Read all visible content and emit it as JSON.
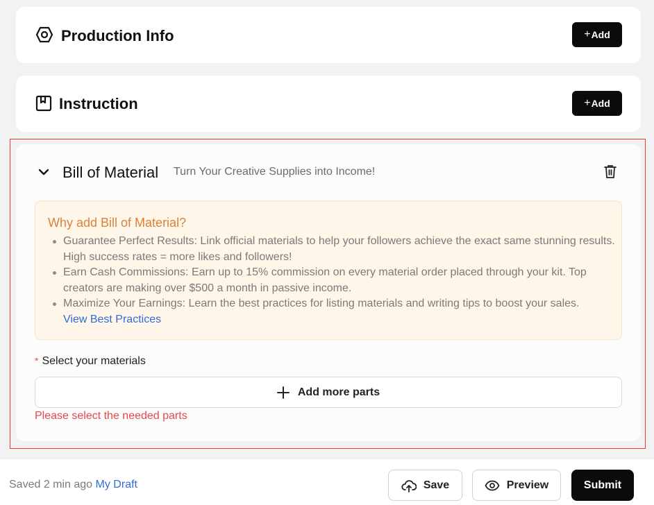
{
  "production": {
    "title": "Production Info",
    "add_label": "Add",
    "add_plus": "+"
  },
  "instruction": {
    "title": "Instruction",
    "add_label": "Add",
    "add_plus": "+"
  },
  "bom": {
    "title": "Bill of Material",
    "subtitle": "Turn Your Creative Supplies into Income!",
    "why_title": "Why add Bill of Material?",
    "bullets": [
      "Guarantee Perfect Results: Link official materials to help your followers achieve the exact same stunning results. High success rates = more likes and followers!",
      "Earn Cash Commissions: Earn up to 15% commission on every material order placed through your kit. Top creators are making over $500 a month in passive income.",
      "Maximize Your Earnings: Learn the best practices for listing materials and writing tips to boost your sales."
    ],
    "link": "View Best Practices",
    "required_mark": "*",
    "select_label": "Select your materials",
    "add_parts_label": "Add more parts",
    "error": "Please select the needed parts"
  },
  "footer": {
    "saved": "Saved 2 min ago",
    "draft_link": "My Draft",
    "save_label": "Save",
    "preview_label": "Preview",
    "submit_label": "Submit"
  },
  "colors": {
    "accent_dark": "#0b0b0b",
    "error": "#e5484d",
    "highlight_border": "#e2412f",
    "info_title": "#d9823b",
    "link": "#2f6bd9"
  }
}
